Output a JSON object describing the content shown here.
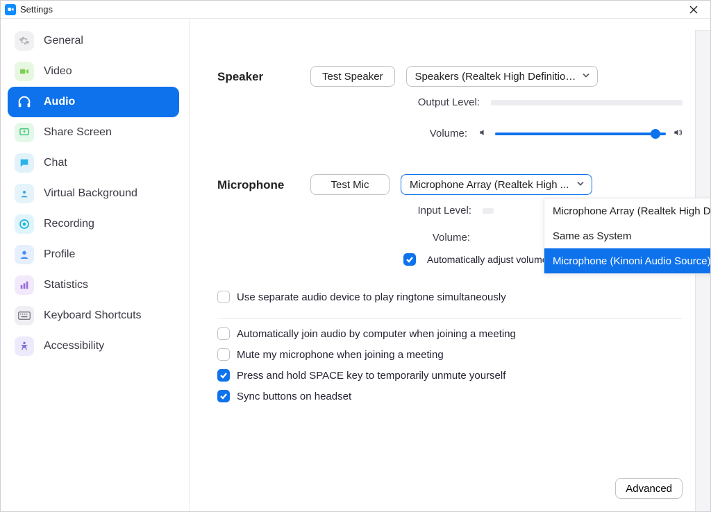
{
  "window": {
    "title": "Settings"
  },
  "sidebar": {
    "items": [
      {
        "id": "general",
        "label": "General"
      },
      {
        "id": "video",
        "label": "Video"
      },
      {
        "id": "audio",
        "label": "Audio"
      },
      {
        "id": "share-screen",
        "label": "Share Screen"
      },
      {
        "id": "chat",
        "label": "Chat"
      },
      {
        "id": "virtual-background",
        "label": "Virtual Background"
      },
      {
        "id": "recording",
        "label": "Recording"
      },
      {
        "id": "profile",
        "label": "Profile"
      },
      {
        "id": "statistics",
        "label": "Statistics"
      },
      {
        "id": "keyboard-shortcuts",
        "label": "Keyboard Shortcuts"
      },
      {
        "id": "accessibility",
        "label": "Accessibility"
      }
    ],
    "active_index": 2
  },
  "speaker": {
    "section_label": "Speaker",
    "test_label": "Test Speaker",
    "selected": "Speakers (Realtek High Definition...",
    "output_label": "Output Level:",
    "volume_label": "Volume:",
    "volume_percent": 94
  },
  "microphone": {
    "section_label": "Microphone",
    "test_label": "Test Mic",
    "selected": "Microphone Array (Realtek High ...",
    "input_label": "Input Level:",
    "volume_label": "Volume:",
    "dropdown": {
      "options": [
        "Microphone Array (Realtek High Defini...",
        "Same as System",
        "Microphone (Kinoni Audio Source)"
      ],
      "highlight_index": 2
    },
    "auto_adjust": {
      "label": "Automatically adjust volume",
      "checked": true
    }
  },
  "checkboxes": {
    "separate_device": {
      "label": "Use separate audio device to play ringtone simultaneously",
      "checked": false
    },
    "auto_join": {
      "label": "Automatically join audio by computer when joining a meeting",
      "checked": false
    },
    "mute_on_join": {
      "label": "Mute my microphone when joining a meeting",
      "checked": false
    },
    "space_unmute": {
      "label": "Press and hold SPACE key to temporarily unmute yourself",
      "checked": true
    },
    "sync_headset": {
      "label": "Sync buttons on headset",
      "checked": true
    }
  },
  "advanced_label": "Advanced"
}
